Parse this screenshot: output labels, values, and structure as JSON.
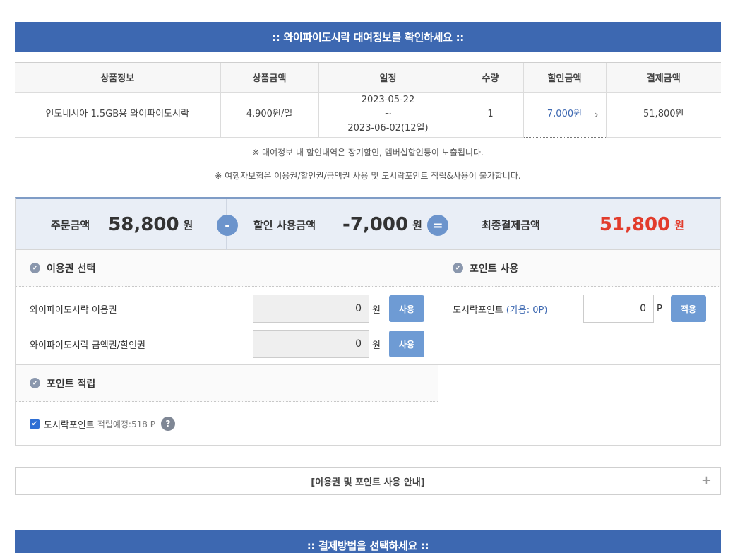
{
  "rental_header": ":: 와이파이도시락 대여정보를 확인하세요 ::",
  "table": {
    "headers": [
      "상품정보",
      "상품금액",
      "일정",
      "수량",
      "할인금액",
      "결제금액"
    ],
    "row": {
      "product": "인도네시아 1.5GB용 와이파이도시락",
      "price": "4,900원/일",
      "date_start": "2023-05-22",
      "date_sep": "~",
      "date_end": "2023-06-02(12일)",
      "qty": "1",
      "discount": "7,000원",
      "discount_arrow": "›",
      "total": "51,800원"
    }
  },
  "notices": [
    "※ 대여정보 내 할인내역은 장기할인, 멤버십할인등이 노출됩니다.",
    "※ 여행자보험은 이용권/할인권/금액권 사용 및 도시락포인트 적립&사용이 불가합니다."
  ],
  "summary": {
    "order_label": "주문금액",
    "order_amount": "58,800",
    "minus": "-",
    "discount_label": "할인 사용금액",
    "discount_amount": "-7,000",
    "equals": "=",
    "final_label": "최종결제금액",
    "final_amount": "51,800",
    "unit": "원"
  },
  "voucher": {
    "title": "이용권 선택",
    "rows": [
      {
        "label": "와이파이도시락 이용권",
        "value": "0",
        "unit": "원",
        "button": "사용"
      },
      {
        "label": "와이파이도시락 금액권/할인권",
        "value": "0",
        "unit": "원",
        "button": "사용"
      }
    ]
  },
  "point_use": {
    "title": "포인트 사용",
    "label": "도시락포인트",
    "available": "(가용: 0P)",
    "value": "0",
    "unit": "P",
    "button": "적용"
  },
  "point_accrual": {
    "title": "포인트 적립",
    "label": "도시락포인트",
    "estimate": "적립예정:518 P",
    "help": "?",
    "checked": true
  },
  "guide": {
    "label": "[이용권 및 포인트 사용 안내]",
    "plus": "+"
  },
  "payment_header": ":: 결제방법을 선택하세요 ::",
  "colors": {
    "header_bg": "#3d68b1",
    "final_amount": "#e23c2c",
    "button": "#6e9bd4"
  }
}
